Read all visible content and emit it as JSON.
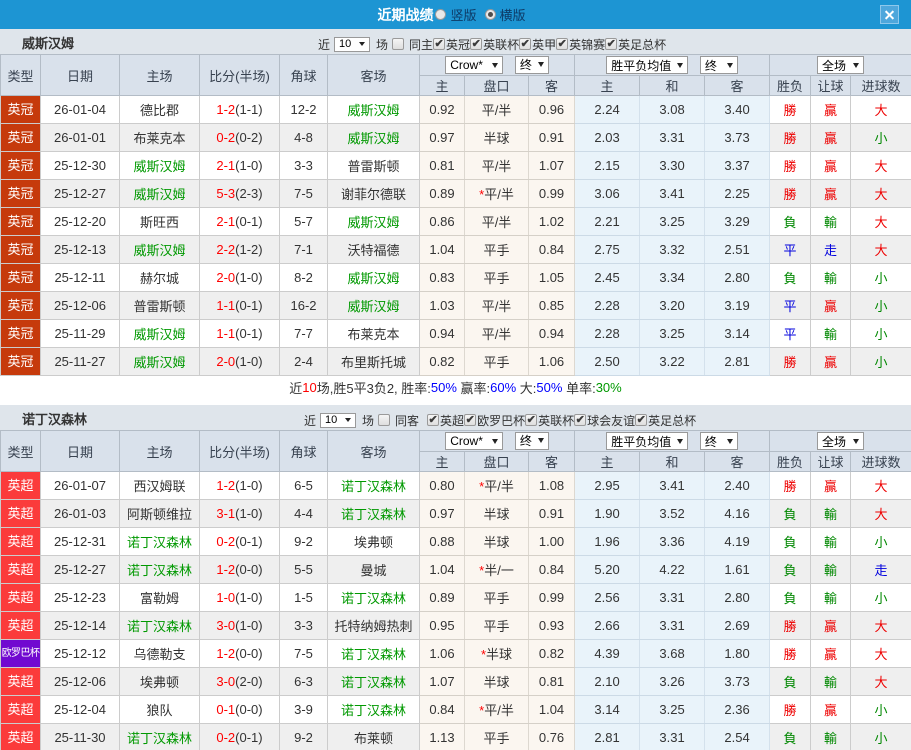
{
  "titlebar": {
    "title": "近期战绩",
    "vertical_label": "竖版",
    "horizontal_label": "横版",
    "vertical_checked": false,
    "horizontal_checked": true
  },
  "columns": {
    "type": "类型",
    "date": "日期",
    "home": "主场",
    "score": "比分(半场)",
    "corner": "角球",
    "away": "客场",
    "asia_home": "主",
    "asia_line": "盘口",
    "asia_away": "客",
    "euro_home": "主",
    "euro_draw": "和",
    "euro_away": "客",
    "result_wdl": "胜负",
    "result_handicap": "让球",
    "result_goals": "进球数"
  },
  "header_controls": {
    "company": "Crow*",
    "company_state": "终",
    "euro_mean": "胜平负均值",
    "euro_state": "终",
    "scope": "全场"
  },
  "sections": [
    {
      "team": "威斯汉姆",
      "filters": {
        "near_label": "近",
        "count": "10",
        "matches_label": "场",
        "same_label": "同主",
        "same_checked": false,
        "leagues": [
          {
            "label": "英冠",
            "checked": true
          },
          {
            "label": "英联杯",
            "checked": true
          },
          {
            "label": "英甲",
            "checked": true
          },
          {
            "label": "英锦赛",
            "checked": true
          },
          {
            "label": "英足总杯",
            "checked": true
          }
        ]
      },
      "rows": [
        {
          "type": "英冠",
          "type_color": "#c63a0c",
          "date": "26-01-04",
          "home": "德比郡",
          "home_hl": false,
          "score": "1-2",
          "half": "(1-1)",
          "corner": "12-2",
          "away": "威斯汉姆",
          "away_hl": true,
          "asia_home": "0.92",
          "line_star": "",
          "line": "平/半",
          "asia_away": "0.96",
          "euro_home": "2.24",
          "euro_draw": "3.08",
          "euro_away": "3.40",
          "r_wdl": "勝",
          "r_let": "贏",
          "r_goal": "大"
        },
        {
          "type": "英冠",
          "type_color": "#c63a0c",
          "date": "26-01-01",
          "home": "布莱克本",
          "home_hl": false,
          "score": "0-2",
          "half": "(0-2)",
          "corner": "4-8",
          "away": "威斯汉姆",
          "away_hl": true,
          "asia_home": "0.97",
          "line_star": "",
          "line": "半球",
          "asia_away": "0.91",
          "euro_home": "2.03",
          "euro_draw": "3.31",
          "euro_away": "3.73",
          "r_wdl": "勝",
          "r_let": "贏",
          "r_goal": "小"
        },
        {
          "type": "英冠",
          "type_color": "#c63a0c",
          "date": "25-12-30",
          "home": "威斯汉姆",
          "home_hl": true,
          "score": "2-1",
          "half": "(1-0)",
          "corner": "3-3",
          "away": "普雷斯顿",
          "away_hl": false,
          "asia_home": "0.81",
          "line_star": "",
          "line": "平/半",
          "asia_away": "1.07",
          "euro_home": "2.15",
          "euro_draw": "3.30",
          "euro_away": "3.37",
          "r_wdl": "勝",
          "r_let": "贏",
          "r_goal": "大"
        },
        {
          "type": "英冠",
          "type_color": "#c63a0c",
          "date": "25-12-27",
          "home": "威斯汉姆",
          "home_hl": true,
          "score": "5-3",
          "half": "(2-3)",
          "corner": "7-5",
          "away": "谢菲尔德联",
          "away_hl": false,
          "asia_home": "0.89",
          "line_star": "*",
          "line": "平/半",
          "asia_away": "0.99",
          "euro_home": "3.06",
          "euro_draw": "3.41",
          "euro_away": "2.25",
          "r_wdl": "勝",
          "r_let": "贏",
          "r_goal": "大"
        },
        {
          "type": "英冠",
          "type_color": "#c63a0c",
          "date": "25-12-20",
          "home": "斯旺西",
          "home_hl": false,
          "score": "2-1",
          "half": "(0-1)",
          "corner": "5-7",
          "away": "威斯汉姆",
          "away_hl": true,
          "asia_home": "0.86",
          "line_star": "",
          "line": "平/半",
          "asia_away": "1.02",
          "euro_home": "2.21",
          "euro_draw": "3.25",
          "euro_away": "3.29",
          "r_wdl": "負",
          "r_let": "輸",
          "r_goal": "大"
        },
        {
          "type": "英冠",
          "type_color": "#c63a0c",
          "date": "25-12-13",
          "home": "威斯汉姆",
          "home_hl": true,
          "score": "2-2",
          "half": "(1-2)",
          "corner": "7-1",
          "away": "沃特福德",
          "away_hl": false,
          "asia_home": "1.04",
          "line_star": "",
          "line": "平手",
          "asia_away": "0.84",
          "euro_home": "2.75",
          "euro_draw": "3.32",
          "euro_away": "2.51",
          "r_wdl": "平",
          "r_let": "走",
          "r_goal": "大"
        },
        {
          "type": "英冠",
          "type_color": "#c63a0c",
          "date": "25-12-11",
          "home": "赫尔城",
          "home_hl": false,
          "score": "2-0",
          "half": "(1-0)",
          "corner": "8-2",
          "away": "威斯汉姆",
          "away_hl": true,
          "asia_home": "0.83",
          "line_star": "",
          "line": "平手",
          "asia_away": "1.05",
          "euro_home": "2.45",
          "euro_draw": "3.34",
          "euro_away": "2.80",
          "r_wdl": "負",
          "r_let": "輸",
          "r_goal": "小"
        },
        {
          "type": "英冠",
          "type_color": "#c63a0c",
          "date": "25-12-06",
          "home": "普雷斯顿",
          "home_hl": false,
          "score": "1-1",
          "half": "(0-1)",
          "corner": "16-2",
          "away": "威斯汉姆",
          "away_hl": true,
          "asia_home": "1.03",
          "line_star": "",
          "line": "平/半",
          "asia_away": "0.85",
          "euro_home": "2.28",
          "euro_draw": "3.20",
          "euro_away": "3.19",
          "r_wdl": "平",
          "r_let": "贏",
          "r_goal": "小"
        },
        {
          "type": "英冠",
          "type_color": "#c63a0c",
          "date": "25-11-29",
          "home": "威斯汉姆",
          "home_hl": true,
          "score": "1-1",
          "half": "(0-1)",
          "corner": "7-7",
          "away": "布莱克本",
          "away_hl": false,
          "asia_home": "0.94",
          "line_star": "",
          "line": "平/半",
          "asia_away": "0.94",
          "euro_home": "2.28",
          "euro_draw": "3.25",
          "euro_away": "3.14",
          "r_wdl": "平",
          "r_let": "輸",
          "r_goal": "小"
        },
        {
          "type": "英冠",
          "type_color": "#c63a0c",
          "date": "25-11-27",
          "home": "威斯汉姆",
          "home_hl": true,
          "score": "2-0",
          "half": "(1-0)",
          "corner": "2-4",
          "away": "布里斯托城",
          "away_hl": false,
          "asia_home": "0.82",
          "line_star": "",
          "line": "平手",
          "asia_away": "1.06",
          "euro_home": "2.50",
          "euro_draw": "3.22",
          "euro_away": "2.81",
          "r_wdl": "勝",
          "r_let": "贏",
          "r_goal": "小"
        }
      ],
      "summary": [
        {
          "text": "近",
          "color": "#333333"
        },
        {
          "text": "10",
          "color": "#ff0000"
        },
        {
          "text": "场,胜5平3负2, 胜率:",
          "color": "#333333"
        },
        {
          "text": "50%",
          "color": "#0000ff"
        },
        {
          "text": " 赢率:",
          "color": "#333333"
        },
        {
          "text": "60%",
          "color": "#0000ff"
        },
        {
          "text": " 大:",
          "color": "#333333"
        },
        {
          "text": "50%",
          "color": "#0000ff"
        },
        {
          "text": " 单率:",
          "color": "#333333"
        },
        {
          "text": "30%",
          "color": "#009900"
        }
      ]
    },
    {
      "team": "诺丁汉森林",
      "filters": {
        "near_label": "近",
        "count": "10",
        "matches_label": "场",
        "same_label": "同客",
        "same_checked": false,
        "leagues": [
          {
            "label": "英超",
            "checked": true
          },
          {
            "label": "欧罗巴杯",
            "checked": true
          },
          {
            "label": "英联杯",
            "checked": true
          },
          {
            "label": "球会友谊",
            "checked": true
          },
          {
            "label": "英足总杯",
            "checked": true
          }
        ]
      },
      "rows": [
        {
          "type": "英超",
          "type_color": "#fb3b3b",
          "date": "26-01-07",
          "home": "西汉姆联",
          "home_hl": false,
          "score": "1-2",
          "half": "(1-0)",
          "corner": "6-5",
          "away": "诺丁汉森林",
          "away_hl": true,
          "asia_home": "0.80",
          "line_star": "*",
          "line": "平/半",
          "asia_away": "1.08",
          "euro_home": "2.95",
          "euro_draw": "3.41",
          "euro_away": "2.40",
          "r_wdl": "勝",
          "r_let": "贏",
          "r_goal": "大"
        },
        {
          "type": "英超",
          "type_color": "#fb3b3b",
          "date": "26-01-03",
          "home": "阿斯顿维拉",
          "home_hl": false,
          "score": "3-1",
          "half": "(1-0)",
          "corner": "4-4",
          "away": "诺丁汉森林",
          "away_hl": true,
          "asia_home": "0.97",
          "line_star": "",
          "line": "半球",
          "asia_away": "0.91",
          "euro_home": "1.90",
          "euro_draw": "3.52",
          "euro_away": "4.16",
          "r_wdl": "負",
          "r_let": "輸",
          "r_goal": "大"
        },
        {
          "type": "英超",
          "type_color": "#fb3b3b",
          "date": "25-12-31",
          "home": "诺丁汉森林",
          "home_hl": true,
          "score": "0-2",
          "half": "(0-1)",
          "corner": "9-2",
          "away": "埃弗顿",
          "away_hl": false,
          "asia_home": "0.88",
          "line_star": "",
          "line": "半球",
          "asia_away": "1.00",
          "euro_home": "1.96",
          "euro_draw": "3.36",
          "euro_away": "4.19",
          "r_wdl": "負",
          "r_let": "輸",
          "r_goal": "小"
        },
        {
          "type": "英超",
          "type_color": "#fb3b3b",
          "date": "25-12-27",
          "home": "诺丁汉森林",
          "home_hl": true,
          "score": "1-2",
          "half": "(0-0)",
          "corner": "5-5",
          "away": "曼城",
          "away_hl": false,
          "asia_home": "1.04",
          "line_star": "*",
          "line": "半/一",
          "asia_away": "0.84",
          "euro_home": "5.20",
          "euro_draw": "4.22",
          "euro_away": "1.61",
          "r_wdl": "負",
          "r_let": "輸",
          "r_goal": "走"
        },
        {
          "type": "英超",
          "type_color": "#fb3b3b",
          "date": "25-12-23",
          "home": "富勒姆",
          "home_hl": false,
          "score": "1-0",
          "half": "(1-0)",
          "corner": "1-5",
          "away": "诺丁汉森林",
          "away_hl": true,
          "asia_home": "0.89",
          "line_star": "",
          "line": "平手",
          "asia_away": "0.99",
          "euro_home": "2.56",
          "euro_draw": "3.31",
          "euro_away": "2.80",
          "r_wdl": "負",
          "r_let": "輸",
          "r_goal": "小"
        },
        {
          "type": "英超",
          "type_color": "#fb3b3b",
          "date": "25-12-14",
          "home": "诺丁汉森林",
          "home_hl": true,
          "score": "3-0",
          "half": "(1-0)",
          "corner": "3-3",
          "away": "托特纳姆热刺",
          "away_hl": false,
          "asia_home": "0.95",
          "line_star": "",
          "line": "平手",
          "asia_away": "0.93",
          "euro_home": "2.66",
          "euro_draw": "3.31",
          "euro_away": "2.69",
          "r_wdl": "勝",
          "r_let": "贏",
          "r_goal": "大"
        },
        {
          "type": "欧罗巴杯",
          "type_color": "#7109d0",
          "date": "25-12-12",
          "home": "乌德勒支",
          "home_hl": false,
          "score": "1-2",
          "half": "(0-0)",
          "corner": "7-5",
          "away": "诺丁汉森林",
          "away_hl": true,
          "asia_home": "1.06",
          "line_star": "*",
          "line": "半球",
          "asia_away": "0.82",
          "euro_home": "4.39",
          "euro_draw": "3.68",
          "euro_away": "1.80",
          "r_wdl": "勝",
          "r_let": "贏",
          "r_goal": "大"
        },
        {
          "type": "英超",
          "type_color": "#fb3b3b",
          "date": "25-12-06",
          "home": "埃弗顿",
          "home_hl": false,
          "score": "3-0",
          "half": "(2-0)",
          "corner": "6-3",
          "away": "诺丁汉森林",
          "away_hl": true,
          "asia_home": "1.07",
          "line_star": "",
          "line": "半球",
          "asia_away": "0.81",
          "euro_home": "2.10",
          "euro_draw": "3.26",
          "euro_away": "3.73",
          "r_wdl": "負",
          "r_let": "輸",
          "r_goal": "大"
        },
        {
          "type": "英超",
          "type_color": "#fb3b3b",
          "date": "25-12-04",
          "home": "狼队",
          "home_hl": false,
          "score": "0-1",
          "half": "(0-0)",
          "corner": "3-9",
          "away": "诺丁汉森林",
          "away_hl": true,
          "asia_home": "0.84",
          "line_star": "*",
          "line": "平/半",
          "asia_away": "1.04",
          "euro_home": "3.14",
          "euro_draw": "3.25",
          "euro_away": "2.36",
          "r_wdl": "勝",
          "r_let": "贏",
          "r_goal": "小"
        },
        {
          "type": "英超",
          "type_color": "#fb3b3b",
          "date": "25-11-30",
          "home": "诺丁汉森林",
          "home_hl": true,
          "score": "0-2",
          "half": "(0-1)",
          "corner": "9-2",
          "away": "布莱顿",
          "away_hl": false,
          "asia_home": "1.13",
          "line_star": "",
          "line": "平手",
          "asia_away": "0.76",
          "euro_home": "2.81",
          "euro_draw": "3.31",
          "euro_away": "2.54",
          "r_wdl": "負",
          "r_let": "輸",
          "r_goal": "小"
        }
      ],
      "summary": null
    }
  ],
  "colors": {
    "titlebar_bg": "#1d95d3",
    "accent_green": "#009900",
    "score_red": "#ff0000",
    "result_red": "#ee0000",
    "result_green": "#008800",
    "result_blue": "#0000dd"
  }
}
